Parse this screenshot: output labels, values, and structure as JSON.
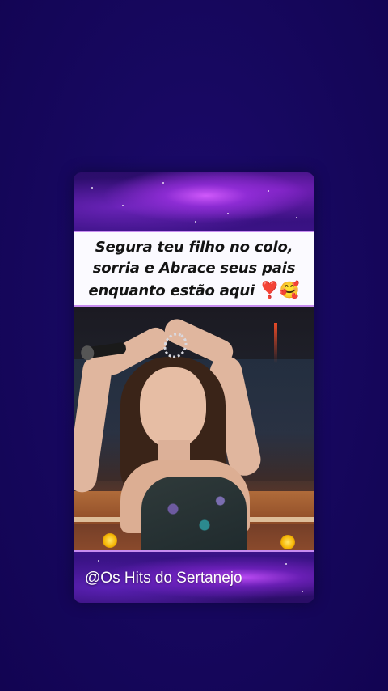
{
  "caption": {
    "line1": "Segura teu filho no colo,",
    "line2": "sorria e Abrace seus pais",
    "line3": "enquanto estão aqui",
    "emoji1": "❣️",
    "emoji2": "🥰"
  },
  "watermark": "@Os Hits do Sertanejo",
  "colors": {
    "page_background": "#17085e",
    "caption_background": "#fbfaff",
    "caption_border": "#c78cf0",
    "caption_text": "#141414",
    "watermark_text": "#ffffff"
  }
}
